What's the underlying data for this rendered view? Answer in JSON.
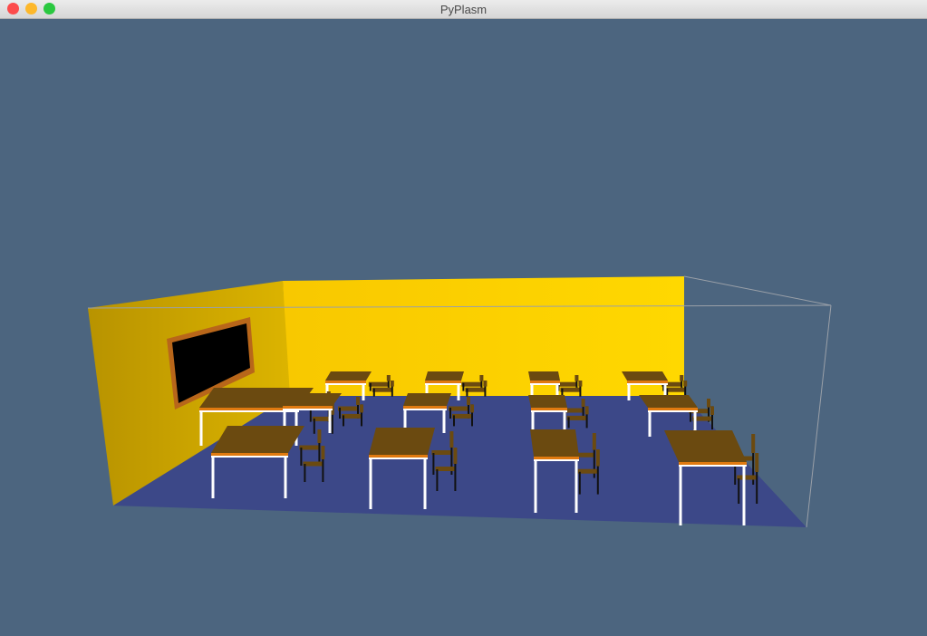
{
  "window": {
    "title": "PyPlasm",
    "controls": {
      "close_color": "#fc4b4b",
      "minimize_color": "#fdb82b",
      "zoom_color": "#2ac840"
    }
  },
  "scene": {
    "background_color": "#4c657f",
    "back_wall_color": "#ffd600",
    "left_wall_color": "#c9a100",
    "floor_color": "#3c4888",
    "desk_top_color": "#6b4a10",
    "desk_edge_color": "#e07a10",
    "leg_color": "#ffffff",
    "blackboard_color": "#000000",
    "blackboard_frame_color": "#b8661a"
  }
}
